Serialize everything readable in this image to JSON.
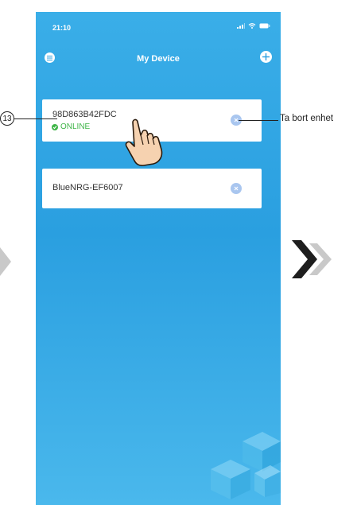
{
  "status_bar": {
    "time": "21:10"
  },
  "nav": {
    "title": "My Device"
  },
  "devices": [
    {
      "name": "98D863B42FDC",
      "status": "ONLINE"
    },
    {
      "name": "BlueNRG-EF6007",
      "status": ""
    }
  ],
  "callouts": {
    "number": "13",
    "remove_label": "Ta bort enhet"
  },
  "colors": {
    "background_blue": "#2a9fe0",
    "online_green": "#3fb548",
    "remove_button": "#a9c6ef"
  }
}
